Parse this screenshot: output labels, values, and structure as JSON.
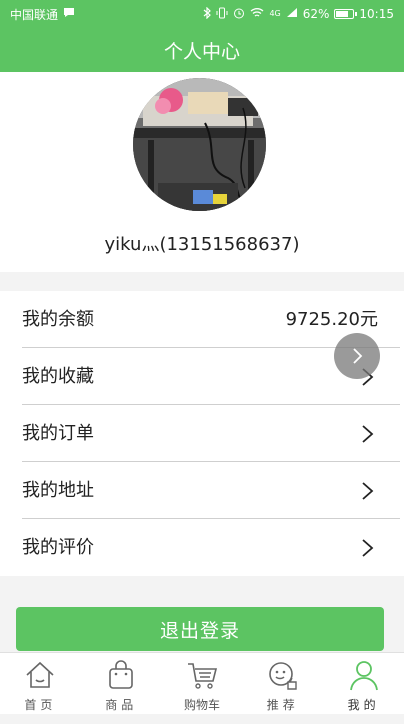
{
  "status_bar": {
    "carrier": "中国联通",
    "battery_percent": "62%",
    "battery_level": 0.62,
    "time": "10:15",
    "network": "4G",
    "icons": [
      "message-icon",
      "bluetooth-icon",
      "vibrate-icon",
      "alarm-icon",
      "wifi-icon",
      "signal-icon",
      "battery-icon"
    ]
  },
  "header": {
    "title": "个人中心"
  },
  "profile": {
    "username": "yiku灬(13151568637)"
  },
  "menu": {
    "balance": {
      "label": "我的余额",
      "value": "9725.20元"
    },
    "items": [
      {
        "label": "我的收藏"
      },
      {
        "label": "我的订单"
      },
      {
        "label": "我的地址"
      },
      {
        "label": "我的评价"
      }
    ]
  },
  "logout_label": "退出登录",
  "tabs": [
    {
      "label": "首页",
      "icon": "home-icon"
    },
    {
      "label": "商品",
      "icon": "shopping-bag-icon"
    },
    {
      "label": "购物车",
      "icon": "cart-icon"
    },
    {
      "label": "推荐",
      "icon": "recommend-icon"
    },
    {
      "label": "我的",
      "icon": "user-icon",
      "active": true
    }
  ],
  "colors": {
    "accent": "#5cc462",
    "background": "#f3f3f3",
    "text": "#222222"
  }
}
